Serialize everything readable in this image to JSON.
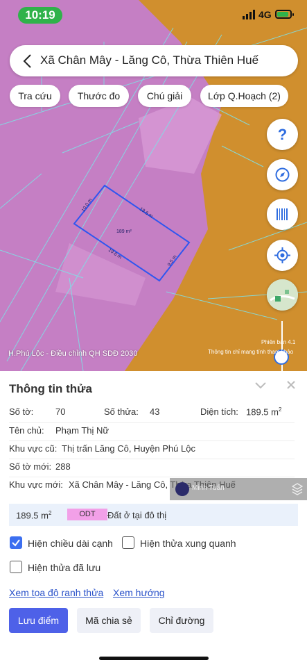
{
  "status_bar": {
    "time": "10:19",
    "network": "4G"
  },
  "search": {
    "title": "Xã Chân Mây - Lăng Cô, Thừa Thiên Huế"
  },
  "chips": [
    "Tra cứu",
    "Thước đo",
    "Chú giải",
    "Lớp Q.Hoạch (2)"
  ],
  "fab": {
    "help": "?"
  },
  "map": {
    "parcel_area": "189 m²",
    "edge_top": "19.6 m",
    "edge_left": "10.0 m",
    "edge_bottom": "19.6 m",
    "edge_right": "9.5 m",
    "label_left": "H.Phú Lộc - Điều chỉnh QH SDĐ 2030",
    "version": "Phiên bản 4.1",
    "note": "Thông tin chỉ mang tính tham khảo",
    "colors": {
      "residential": "#c57fc4",
      "orange_zone": "#d08f2e",
      "parcel_outline": "#2f56f0"
    }
  },
  "panel": {
    "title": "Thông tin thửa",
    "so_to_label": "Số tờ:",
    "so_to": "70",
    "so_thua_label": "Số thửa:",
    "so_thua": "43",
    "dien_tich_label": "Diện tích:",
    "dien_tich": "189.5 m",
    "dien_tich_sup": "2",
    "owner_label": "Tên chủ:",
    "owner": "Phạm Thị Nữ",
    "old_area_label": "Khu vực cũ:",
    "old_area": "Thị trấn Lăng Cô, Huyện Phú Lộc",
    "new_sheet_label": "Số tờ mới:",
    "new_sheet": "288",
    "new_area_label": "Khu vực mới:",
    "new_area": "Xã Chân Mây - Lăng Cô, Thừa Thiên Huế",
    "overlay_text": "Minh Tuấn",
    "land": {
      "area": "189.5 m",
      "area_sup": "2",
      "code": "ODT",
      "type": "Đất ở tại đô thị"
    },
    "checkbox_edges": "Hiện chiều dài cạnh",
    "checkbox_neighbors": "Hiện thửa xung quanh",
    "checkbox_saved": "Hiện thửa đã lưu",
    "link_coords": "Xem tọa độ ranh thửa",
    "link_direction": "Xem hướng",
    "btn_save": "Lưu điểm",
    "btn_share": "Mã chia sẻ",
    "btn_route": "Chỉ đường"
  }
}
